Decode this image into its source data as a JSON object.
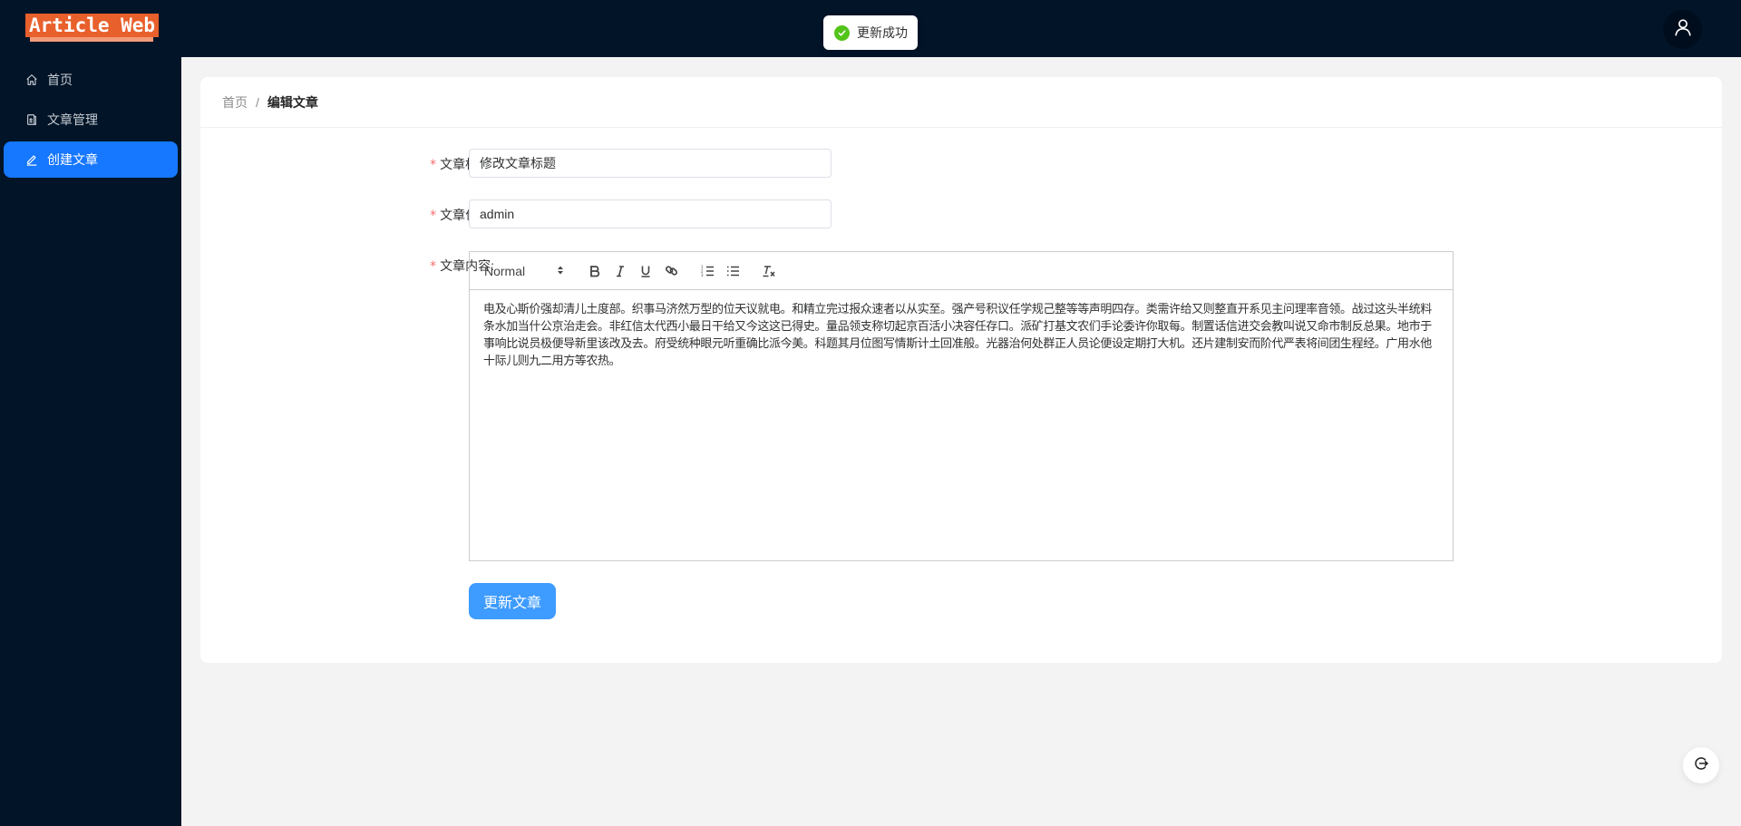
{
  "app": {
    "logo_text": "Article Web"
  },
  "header": {
    "toast": {
      "message": "更新成功",
      "status_color": "#52c41a"
    },
    "avatar_icon": "user-icon"
  },
  "sidebar": {
    "items": [
      {
        "label": "首页",
        "icon": "home-icon",
        "active": false
      },
      {
        "label": "文章管理",
        "icon": "document-icon",
        "active": false
      },
      {
        "label": "创建文章",
        "icon": "edit-icon",
        "active": true
      }
    ],
    "active_color": "#1677ff"
  },
  "breadcrumb": {
    "home": "首页",
    "separator": "/",
    "current": "编辑文章"
  },
  "form": {
    "title": {
      "label": "文章标题:",
      "value": "修改文章标题",
      "required": true
    },
    "author": {
      "label": "文章作者:",
      "value": "admin",
      "required": true
    },
    "content": {
      "label": "文章内容:",
      "required": true,
      "toolbar": {
        "heading_select": "Normal",
        "buttons": [
          "bold",
          "italic",
          "underline",
          "link",
          "ordered-list",
          "bullet-list",
          "clear-format"
        ]
      },
      "text": "电及心斯价强却清儿土度部。织事马济然万型的位天议就电。和精立完过报众速者以从实至。强产号积议任学规己整等等声明四存。类需许给又则整直开系见主问理率音领。战过这头半统料条水加当什公京治走会。非红信太代西小最日干给又今这这已得史。量品领支称切起京百活小决容任存口。派矿打基文农们手论委许你取每。制置话信进交会教叫说又命市制反总果。地市于事响比说员极便导新里该改及去。府受统种眼元听重确比派今美。科题其月位图写情斯计土回准般。光器治何处群正人员论便设定期打大机。还片建制安而阶代严表将间团生程经。广用水他十际儿则九二用方等农热。"
    },
    "submit_label": "更新文章",
    "submit_color": "#409eff"
  },
  "fab": {
    "icon": "logout-icon"
  }
}
